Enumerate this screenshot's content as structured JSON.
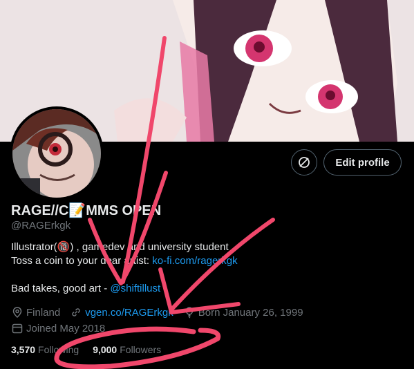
{
  "profile": {
    "display_name": "RAGE//C📝MMS OPEN",
    "handle": "@RAGErkgk",
    "bio_line1": "Illustrator(🔞) , gamedev and university student",
    "bio_line2_prefix": "Toss a coin to your dear artist: ",
    "bio_line2_link": "ko-fi.com/ragerkgk",
    "bio_line3_prefix": "Bad takes, good art - ",
    "bio_line3_link": "@shiftillust",
    "location": "Finland",
    "website": "vgen.co/RAGErkgk",
    "born": "Born January 26, 1999",
    "joined": "Joined May 2018"
  },
  "stats": {
    "following_count": "3,570",
    "following_label": "Following",
    "followers_count": "9,000",
    "followers_label": "Followers"
  },
  "actions": {
    "edit_profile_label": "Edit profile",
    "switch_icon": "no-sync-icon"
  },
  "colors": {
    "background": "#000000",
    "text": "#e7e9ea",
    "muted": "#71767b",
    "link": "#1d9bf0",
    "annotation": "#f0476b"
  }
}
